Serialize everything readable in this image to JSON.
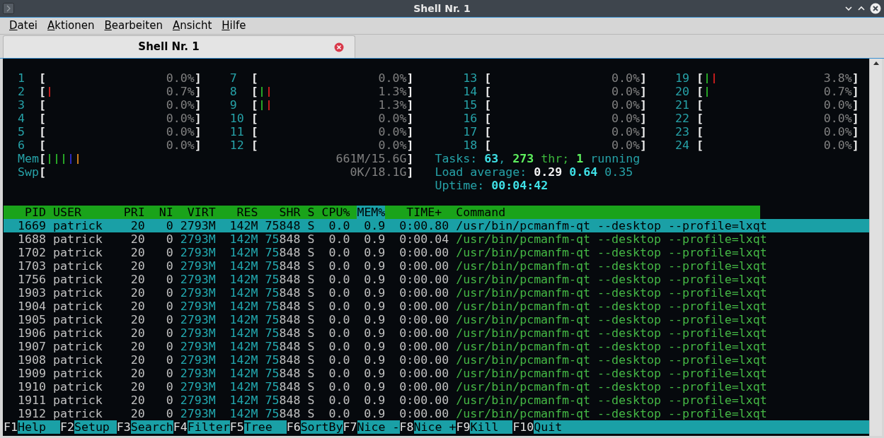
{
  "window": {
    "title": "Shell Nr. 1"
  },
  "menu": [
    {
      "label": "Datei"
    },
    {
      "label": "Aktionen"
    },
    {
      "label": "Bearbeiten"
    },
    {
      "label": "Ansicht"
    },
    {
      "label": "Hilfe"
    }
  ],
  "tabs": [
    {
      "label": "Shell Nr. 1",
      "selected": true
    }
  ],
  "cpu_rows": [
    [
      {
        "label": "1",
        "open": "[",
        "percent": "0.0%",
        "close": "]"
      },
      {
        "label": "7",
        "open": "[",
        "percent": "0.0%",
        "close": "]"
      },
      {
        "label": "13",
        "open": "[",
        "percent": "0.0%",
        "close": "]"
      },
      {
        "label": "19",
        "open": "[",
        "segments": [
          {
            "color": "#26a326"
          },
          {
            "color": "#c01c1c"
          }
        ],
        "percent": "3.8%",
        "close": "]"
      }
    ],
    [
      {
        "label": "2",
        "open": "[",
        "segments": [
          {
            "color": "#c01c1c"
          }
        ],
        "percent": "0.7%",
        "close": "]"
      },
      {
        "label": "8",
        "open": "[",
        "segments": [
          {
            "color": "#26a326"
          },
          {
            "color": "#c01c1c"
          }
        ],
        "percent": "1.3%",
        "close": "]"
      },
      {
        "label": "14",
        "open": "[",
        "percent": "0.0%",
        "close": "]"
      },
      {
        "label": "20",
        "open": "[",
        "segments": [
          {
            "color": "#26a326"
          }
        ],
        "percent": "0.7%",
        "close": "]"
      }
    ],
    [
      {
        "label": "3",
        "open": "[",
        "percent": "0.0%",
        "close": "]"
      },
      {
        "label": "9",
        "open": "[",
        "segments": [
          {
            "color": "#26a326"
          },
          {
            "color": "#c01c1c"
          }
        ],
        "percent": "1.3%",
        "close": "]"
      },
      {
        "label": "15",
        "open": "[",
        "percent": "0.0%",
        "close": "]"
      },
      {
        "label": "21",
        "open": "[",
        "percent": "0.0%",
        "close": "]"
      }
    ],
    [
      {
        "label": "4",
        "open": "[",
        "percent": "0.0%",
        "close": "]"
      },
      {
        "label": "10",
        "open": "[",
        "percent": "0.0%",
        "close": "]"
      },
      {
        "label": "16",
        "open": "[",
        "percent": "0.0%",
        "close": "]"
      },
      {
        "label": "22",
        "open": "[",
        "percent": "0.0%",
        "close": "]"
      }
    ],
    [
      {
        "label": "5",
        "open": "[",
        "percent": "0.0%",
        "close": "]"
      },
      {
        "label": "11",
        "open": "[",
        "percent": "0.0%",
        "close": "]"
      },
      {
        "label": "17",
        "open": "[",
        "percent": "0.0%",
        "close": "]"
      },
      {
        "label": "23",
        "open": "[",
        "percent": "0.0%",
        "close": "]"
      }
    ],
    [
      {
        "label": "6",
        "open": "[",
        "percent": "0.0%",
        "close": "]"
      },
      {
        "label": "12",
        "open": "[",
        "percent": "0.0%",
        "close": "]"
      },
      {
        "label": "18",
        "open": "[",
        "percent": "0.0%",
        "close": "]"
      },
      {
        "label": "24",
        "open": "[",
        "percent": "0.0%",
        "close": "]"
      }
    ]
  ],
  "memory": {
    "label": "Mem",
    "open": "[",
    "segments": [
      {
        "color": "#26a326"
      },
      {
        "color": "#26a326"
      },
      {
        "color": "#26a326"
      },
      {
        "color": "#2a2ab8"
      },
      {
        "color": "#c87a1a"
      }
    ],
    "reading": "661M/15.6G",
    "close": "]"
  },
  "tasks": [
    {
      "text": "Tasks: ",
      "kind": "label"
    },
    {
      "text": "63",
      "kind": "value"
    },
    {
      "text": ", ",
      "kind": "label"
    },
    {
      "text": "273",
      "kind": "thread_value"
    },
    {
      "text": " thr; ",
      "kind": "thread_label"
    },
    {
      "text": "1",
      "kind": "thread_value"
    },
    {
      "text": " running",
      "kind": "label"
    }
  ],
  "swap": {
    "label": "Swp",
    "open": "[",
    "reading": "0K/18.1G",
    "close": "]"
  },
  "load_average": {
    "label": "Load average:",
    "values": [
      "0.29",
      "0.64",
      "0.35"
    ]
  },
  "uptime": {
    "label": "Uptime:",
    "value": "00:04:42"
  },
  "table": {
    "columns": [
      {
        "label": "PID",
        "selected": false
      },
      {
        "label": "USER",
        "selected": false
      },
      {
        "label": "PRI",
        "selected": false
      },
      {
        "label": "NI",
        "selected": false
      },
      {
        "label": "VIRT",
        "selected": false
      },
      {
        "label": "RES",
        "selected": false
      },
      {
        "label": "SHR",
        "selected": false
      },
      {
        "label": "S",
        "selected": false
      },
      {
        "label": "CPU%",
        "selected": false
      },
      {
        "label": "MEM%",
        "selected": true
      },
      {
        "label": "TIME+",
        "selected": false
      },
      {
        "label": "Command",
        "selected": false
      }
    ],
    "rows": [
      {
        "selected": true,
        "cells": [
          "1669",
          "patrick",
          "20",
          "0",
          "2793M",
          "142M",
          "75848",
          "S",
          "0.0",
          "0.9",
          "0:00.80",
          "/usr/bin/pcmanfm-qt --desktop --profile=lxqt"
        ]
      },
      {
        "selected": false,
        "cells": [
          "1688",
          "patrick",
          "20",
          "0",
          "2793M",
          "142M",
          "75848",
          "S",
          "0.0",
          "0.9",
          "0:00.04",
          "/usr/bin/pcmanfm-qt --desktop --profile=lxqt"
        ]
      },
      {
        "selected": false,
        "cells": [
          "1702",
          "patrick",
          "20",
          "0",
          "2793M",
          "142M",
          "75848",
          "S",
          "0.0",
          "0.9",
          "0:00.00",
          "/usr/bin/pcmanfm-qt --desktop --profile=lxqt"
        ]
      },
      {
        "selected": false,
        "cells": [
          "1703",
          "patrick",
          "20",
          "0",
          "2793M",
          "142M",
          "75848",
          "S",
          "0.0",
          "0.9",
          "0:00.00",
          "/usr/bin/pcmanfm-qt --desktop --profile=lxqt"
        ]
      },
      {
        "selected": false,
        "cells": [
          "1756",
          "patrick",
          "20",
          "0",
          "2793M",
          "142M",
          "75848",
          "S",
          "0.0",
          "0.9",
          "0:00.00",
          "/usr/bin/pcmanfm-qt --desktop --profile=lxqt"
        ]
      },
      {
        "selected": false,
        "cells": [
          "1903",
          "patrick",
          "20",
          "0",
          "2793M",
          "142M",
          "75848",
          "S",
          "0.0",
          "0.9",
          "0:00.00",
          "/usr/bin/pcmanfm-qt --desktop --profile=lxqt"
        ]
      },
      {
        "selected": false,
        "cells": [
          "1904",
          "patrick",
          "20",
          "0",
          "2793M",
          "142M",
          "75848",
          "S",
          "0.0",
          "0.9",
          "0:00.00",
          "/usr/bin/pcmanfm-qt --desktop --profile=lxqt"
        ]
      },
      {
        "selected": false,
        "cells": [
          "1905",
          "patrick",
          "20",
          "0",
          "2793M",
          "142M",
          "75848",
          "S",
          "0.0",
          "0.9",
          "0:00.00",
          "/usr/bin/pcmanfm-qt --desktop --profile=lxqt"
        ]
      },
      {
        "selected": false,
        "cells": [
          "1906",
          "patrick",
          "20",
          "0",
          "2793M",
          "142M",
          "75848",
          "S",
          "0.0",
          "0.9",
          "0:00.00",
          "/usr/bin/pcmanfm-qt --desktop --profile=lxqt"
        ]
      },
      {
        "selected": false,
        "cells": [
          "1907",
          "patrick",
          "20",
          "0",
          "2793M",
          "142M",
          "75848",
          "S",
          "0.0",
          "0.9",
          "0:00.00",
          "/usr/bin/pcmanfm-qt --desktop --profile=lxqt"
        ]
      },
      {
        "selected": false,
        "cells": [
          "1908",
          "patrick",
          "20",
          "0",
          "2793M",
          "142M",
          "75848",
          "S",
          "0.0",
          "0.9",
          "0:00.00",
          "/usr/bin/pcmanfm-qt --desktop --profile=lxqt"
        ]
      },
      {
        "selected": false,
        "cells": [
          "1909",
          "patrick",
          "20",
          "0",
          "2793M",
          "142M",
          "75848",
          "S",
          "0.0",
          "0.9",
          "0:00.00",
          "/usr/bin/pcmanfm-qt --desktop --profile=lxqt"
        ]
      },
      {
        "selected": false,
        "cells": [
          "1910",
          "patrick",
          "20",
          "0",
          "2793M",
          "142M",
          "75848",
          "S",
          "0.0",
          "0.9",
          "0:00.00",
          "/usr/bin/pcmanfm-qt --desktop --profile=lxqt"
        ]
      },
      {
        "selected": false,
        "cells": [
          "1911",
          "patrick",
          "20",
          "0",
          "2793M",
          "142M",
          "75848",
          "S",
          "0.0",
          "0.9",
          "0:00.00",
          "/usr/bin/pcmanfm-qt --desktop --profile=lxqt"
        ]
      },
      {
        "selected": false,
        "cells": [
          "1912",
          "patrick",
          "20",
          "0",
          "2793M",
          "142M",
          "75848",
          "S",
          "0.0",
          "0.9",
          "0:00.00",
          "/usr/bin/pcmanfm-qt --desktop --profile=lxqt"
        ]
      }
    ]
  },
  "function_keys": [
    {
      "key": "F1",
      "label": "Help"
    },
    {
      "key": "F2",
      "label": "Setup"
    },
    {
      "key": "F3",
      "label": "Search"
    },
    {
      "key": "F4",
      "label": "Filter"
    },
    {
      "key": "F5",
      "label": "Tree"
    },
    {
      "key": "F6",
      "label": "SortBy"
    },
    {
      "key": "F7",
      "label": "Nice -"
    },
    {
      "key": "F8",
      "label": "Nice +"
    },
    {
      "key": "F9",
      "label": "Kill"
    },
    {
      "key": "F10",
      "label": "Quit"
    }
  ]
}
